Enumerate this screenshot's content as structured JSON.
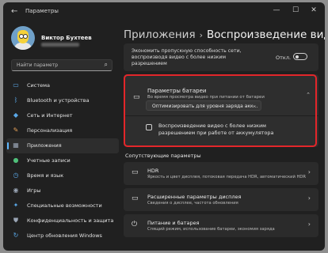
{
  "window": {
    "title": "Параметры",
    "controls": [
      "—",
      "☐",
      "✕"
    ]
  },
  "profile": {
    "name": "Виктор Бухтеев"
  },
  "search": {
    "placeholder": "Найти параметр"
  },
  "sidebar": {
    "items": [
      {
        "label": "Система",
        "icon": "monitor-icon",
        "color": "#5aa8e8",
        "glyph": "▭"
      },
      {
        "label": "Bluetooth и устройства",
        "icon": "bluetooth-icon",
        "color": "#5aa8e8",
        "glyph": "ᛒ"
      },
      {
        "label": "Сеть и Интернет",
        "icon": "network-icon",
        "color": "#5aa8e8",
        "glyph": "◆"
      },
      {
        "label": "Персонализация",
        "icon": "brush-icon",
        "color": "#e7a35a",
        "glyph": "✎"
      },
      {
        "label": "Приложения",
        "icon": "apps-icon",
        "color": "#9aa5b5",
        "glyph": "▦"
      },
      {
        "label": "Учетные записи",
        "icon": "person-icon",
        "color": "#4fbf7a",
        "glyph": "●"
      },
      {
        "label": "Время и язык",
        "icon": "globe-clock-icon",
        "color": "#5aa8e8",
        "glyph": "◷"
      },
      {
        "label": "Игры",
        "icon": "gamepad-icon",
        "color": "#9aa5b5",
        "glyph": "◉"
      },
      {
        "label": "Специальные возможности",
        "icon": "accessibility-icon",
        "color": "#5aa8e8",
        "glyph": "✦"
      },
      {
        "label": "Конфиденциальность и защита",
        "icon": "shield-icon",
        "color": "#9aa5b5",
        "glyph": "⛊"
      },
      {
        "label": "Центр обновления Windows",
        "icon": "update-icon",
        "color": "#5aa8e8",
        "glyph": "↻"
      }
    ],
    "active_index": 4
  },
  "header": {
    "crumb1": "Приложения",
    "separator": "›",
    "crumb2": "Воспроизведение видео"
  },
  "setting_lowres": {
    "text": "Экономить пропускную способность сети, воспроизводя видео с более низким разрешением",
    "state": "Откл."
  },
  "battery": {
    "title": "Параметры батареи",
    "subtitle": "Во время просмотра видео при питании от батареи",
    "dropdown_value": "Оптимизировать для уровня заряда акк...",
    "checkbox_label": "Воспроизведение видео с более низким разрешением при работе от аккумулятора",
    "highlight_color": "#e3262a"
  },
  "related": {
    "heading": "Сопутствующие параметры",
    "items": [
      {
        "title": "HDR",
        "subtitle": "Яркость и цвет дисплея, потоковая передача HDR, автоматический HDR",
        "icon": "display-icon"
      },
      {
        "title": "Расширенные параметры дисплея",
        "subtitle": "Сведения о дисплее, частота обновления",
        "icon": "display-info-icon"
      },
      {
        "title": "Питание и батарея",
        "subtitle": "Спящий режим, использование батареи, экономия заряда",
        "icon": "power-icon"
      }
    ]
  },
  "accent_color": "#60b8ff"
}
